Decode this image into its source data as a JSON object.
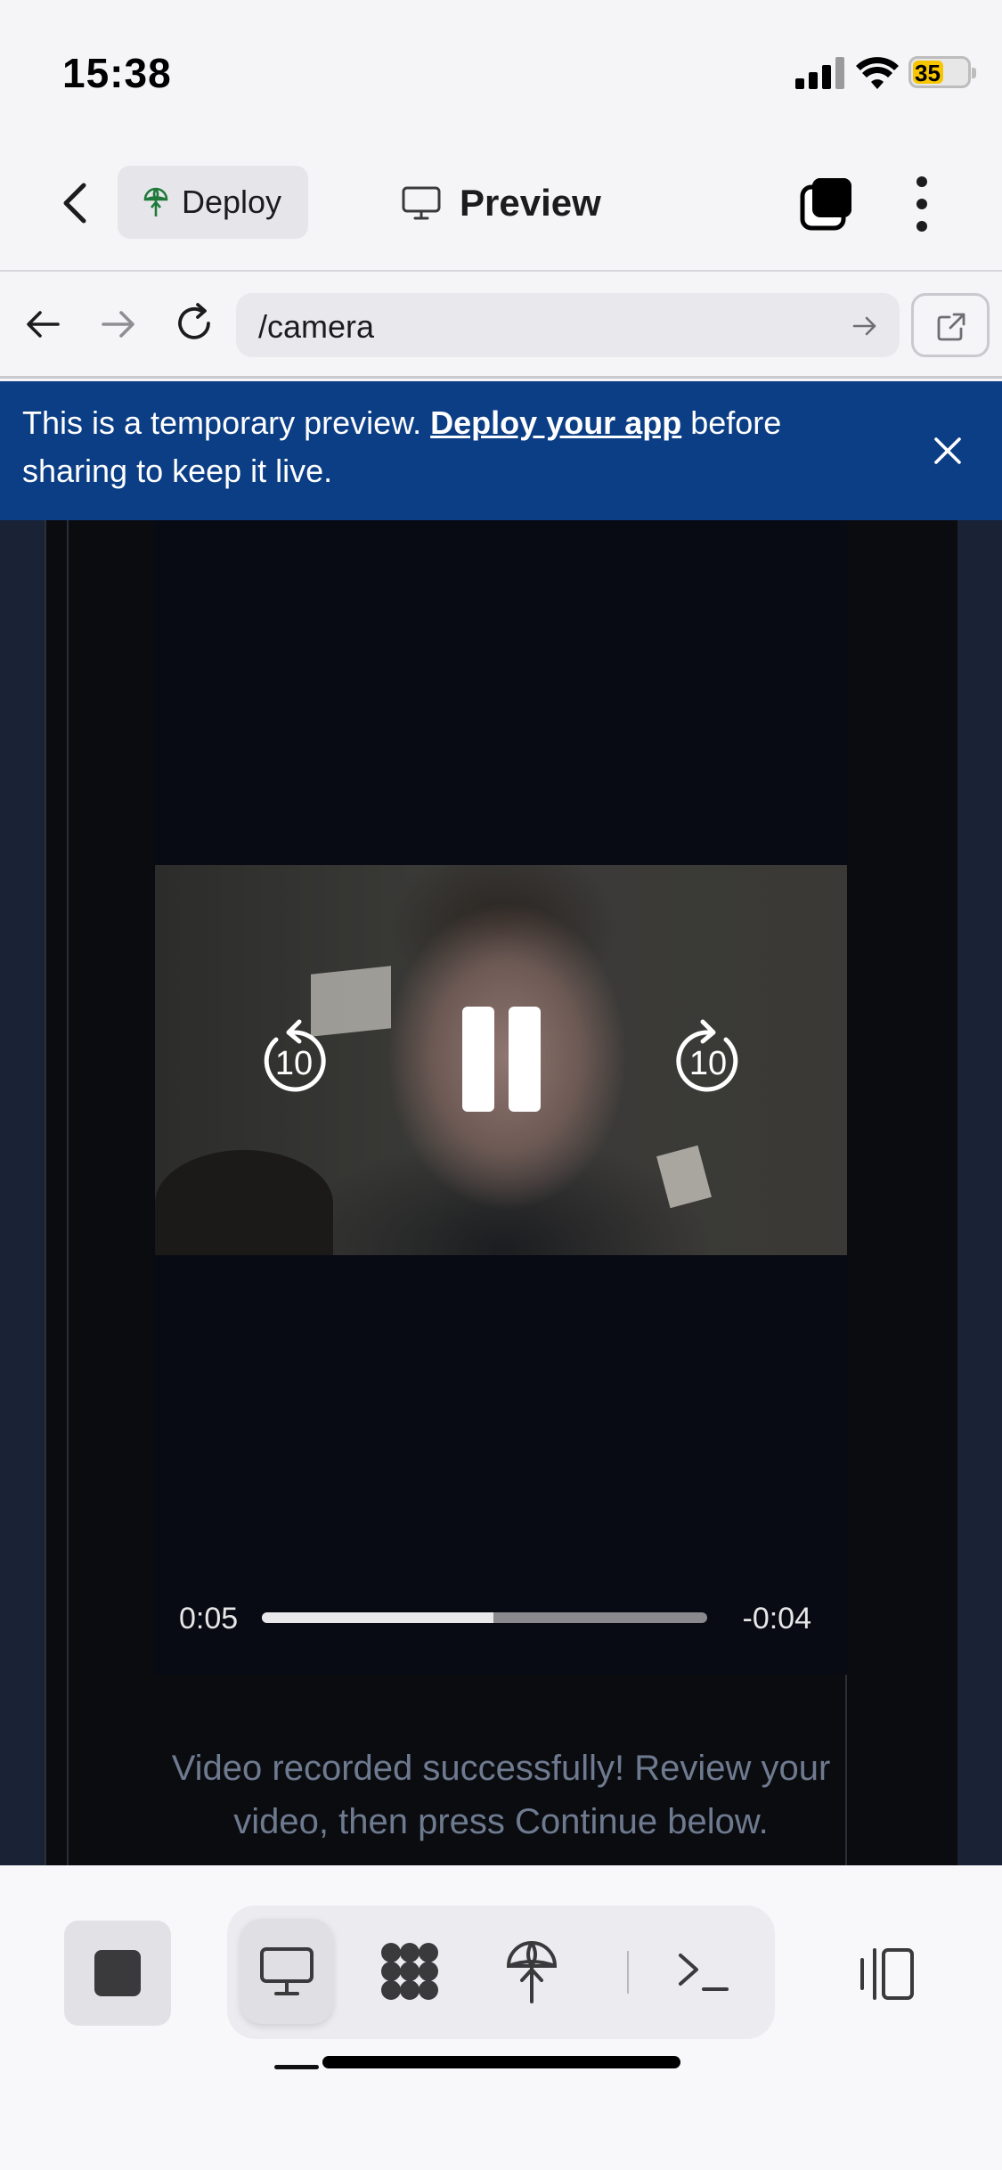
{
  "status_bar": {
    "time": "15:38",
    "battery": "35"
  },
  "header": {
    "deploy_label": "Deploy",
    "preview_label": "Preview"
  },
  "browser": {
    "url": "/camera"
  },
  "banner": {
    "text_before": "This is a temporary preview. ",
    "link": "Deploy your app",
    "text_after": " before sharing to keep it live."
  },
  "player": {
    "rewind_label": "10",
    "forward_label": "10",
    "current_time": "0:05",
    "remaining_time": "-0:04",
    "progress": 0.52
  },
  "app": {
    "message": "Video recorded successfully! Review your video, then press Continue below."
  },
  "colors": {
    "banner_bg": "#0c3e86",
    "battery": "#f7c600",
    "app_bg": "#1a2236"
  },
  "toolbar": {
    "icons": [
      "stop-icon",
      "desktop-icon",
      "workspace-icon",
      "deploy-icon",
      "terminal-icon",
      "panel-icon"
    ]
  }
}
